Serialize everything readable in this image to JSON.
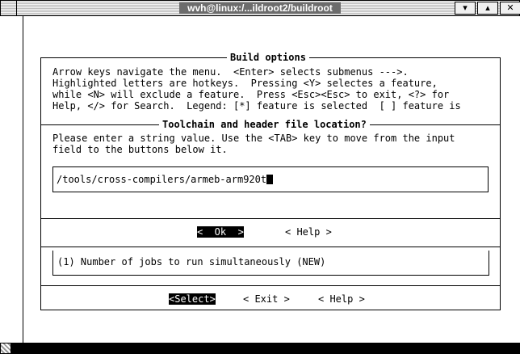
{
  "window": {
    "title": "wvh@linux:/...ildroot2/buildroot",
    "buttons": [
      {
        "name": "menu-down-button",
        "glyph": "▾"
      },
      {
        "name": "maximize-button",
        "glyph": "▴"
      },
      {
        "name": "close-button",
        "glyph": "✕"
      }
    ]
  },
  "build_options": {
    "title": "Build options",
    "help_lines": [
      "Arrow keys navigate the menu.  <Enter> selects submenus --->.",
      "Highlighted letters are hotkeys.  Pressing <Y> selectes a feature,",
      "while <N> will exclude a feature.  Press <Esc><Esc> to exit, <?> for",
      "Help, </> for Search.  Legend: [*] feature is selected  [ ] feature is"
    ],
    "menu_item": "(1) Number of jobs to run simultaneously (NEW)",
    "buttons": {
      "select": "<Select>",
      "exit": "< Exit >",
      "help": "< Help >"
    }
  },
  "dialog": {
    "title": "Toolchain and header file location?",
    "prompt_lines": [
      "Please enter a string value. Use the <TAB> key to move from the input",
      "field to the buttons below it."
    ],
    "input_value": "/tools/cross-compilers/armeb-arm920t",
    "buttons": {
      "ok": "<  Ok  >",
      "help": "< Help >"
    }
  }
}
